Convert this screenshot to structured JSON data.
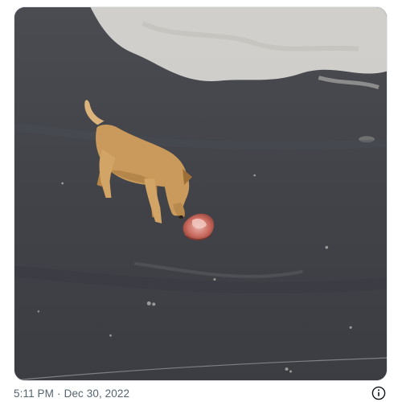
{
  "post": {
    "time": "5:11 PM",
    "separator": "·",
    "date": "Dec 30, 2022"
  },
  "media": {
    "subject": "tan dog sniffing a piece of raw meat on dark asphalt pavement",
    "colors": {
      "asphalt": "#3f4148",
      "sunlit_ground": "#d8d6d2",
      "dog_coat": "#c99a5b",
      "meat": "#c96a5e"
    }
  },
  "icons": {
    "info": "info-circle-icon"
  },
  "colors": {
    "meta_text": "#536471",
    "frame_border": "#e6e9eb"
  }
}
